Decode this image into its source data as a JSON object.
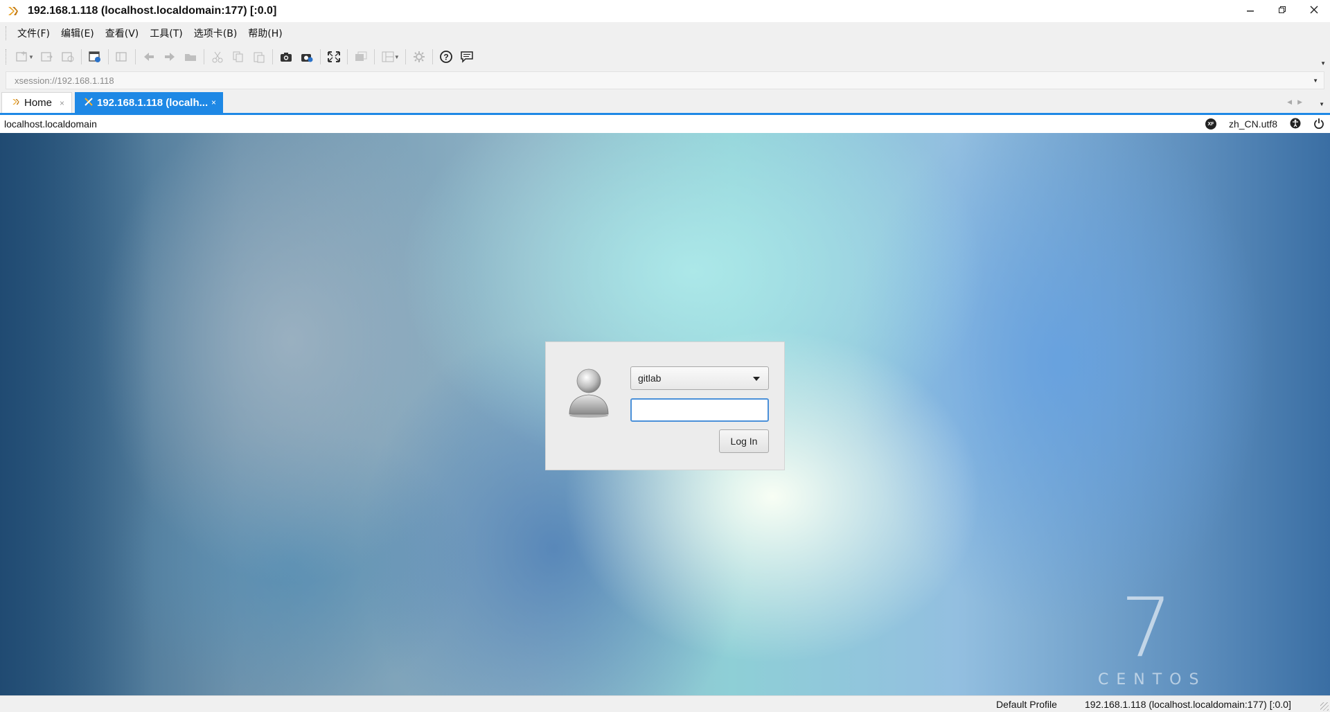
{
  "window": {
    "title": "192.168.1.118 (localhost.localdomain:177) [:0.0]",
    "app_icon": "xmanager-icon",
    "controls": [
      "minimize-icon",
      "restore-icon",
      "close-icon"
    ]
  },
  "menubar": {
    "items": [
      {
        "label": "文件(F)"
      },
      {
        "label": "编辑(E)"
      },
      {
        "label": "查看(V)"
      },
      {
        "label": "工具(T)"
      },
      {
        "label": "选项卡(B)"
      },
      {
        "label": "帮助(H)"
      }
    ]
  },
  "toolbar": {
    "buttons": [
      "new-session-icon",
      "open-icon",
      "disconnect-icon",
      "session-manager-icon",
      "properties-icon",
      "back-icon",
      "forward-icon",
      "folder-icon",
      "cut-icon",
      "copy-icon",
      "paste-icon",
      "screenshot-icon",
      "screenshot-settings-icon",
      "fullscreen-icon",
      "window-mode-icon",
      "layout-icon",
      "settings-icon",
      "help-icon",
      "chat-icon"
    ]
  },
  "address": {
    "value": "xsession://192.168.1.118"
  },
  "tabs": [
    {
      "label": "Home",
      "icon": "xmanager-icon",
      "active": false
    },
    {
      "label": "192.168.1.118 (localh...",
      "icon": "x-session-icon",
      "active": true
    }
  ],
  "session_bar": {
    "hostname": "localhost.localdomain",
    "locale": "zh_CN.utf8",
    "icons": [
      "keyboard-layout-icon",
      "accessibility-icon",
      "power-icon"
    ],
    "keyboard_badge": "XF"
  },
  "desktop": {
    "brand_number": "7",
    "brand_word": "CENTOS"
  },
  "login": {
    "avatar": "user-avatar-icon",
    "username": "gitlab",
    "password_value": "",
    "login_label": "Log In"
  },
  "statusbar": {
    "profile": "Default Profile",
    "session": "192.168.1.118 (localhost.localdomain:177) [:0.0]"
  },
  "colors": {
    "accent": "#1e88e5",
    "focus_border": "#4a90d9"
  }
}
